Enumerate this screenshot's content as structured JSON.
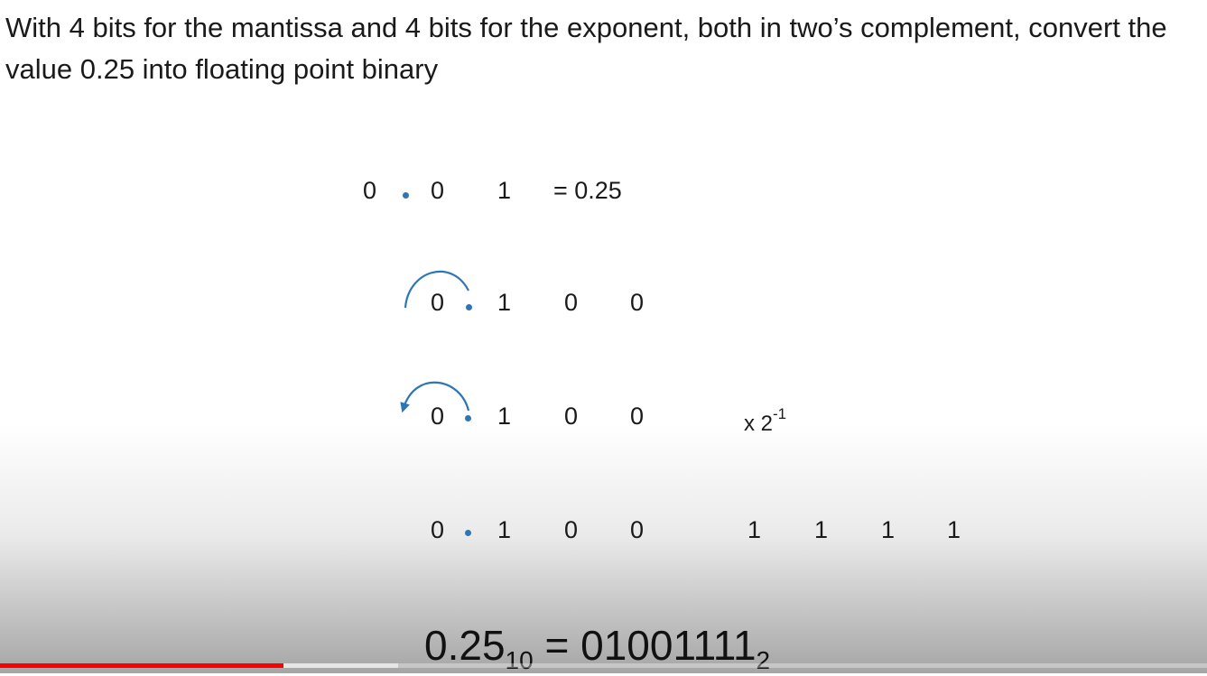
{
  "slide": {
    "title": "With 4 bits for the mantissa and 4 bits for the exponent, both in two’s complement, convert the value 0.25 into floating point binary"
  },
  "rows": {
    "row1": {
      "d1": "0",
      "d2": "0",
      "d3": "1",
      "equals": "= 0.25"
    },
    "row2": {
      "d1": "0",
      "d2": "1",
      "d3": "0",
      "d4": "0"
    },
    "row3": {
      "d1": "0",
      "d2": "1",
      "d3": "0",
      "d4": "0",
      "mult": "x 2",
      "exponent": "-1"
    },
    "row4": {
      "d1": "0",
      "d2": "1",
      "d3": "0",
      "d4": "0",
      "e1": "1",
      "e2": "1",
      "e3": "1",
      "e4": "1"
    }
  },
  "result": {
    "value": "0.25",
    "base_from": "10",
    "equals": "=",
    "binary": "01001111",
    "base_to": "2"
  },
  "player": {
    "progress_played": 0.235,
    "progress_buffered": 0.33
  },
  "colors": {
    "point": "#2e75b6",
    "arrow": "#2e75b6",
    "progress": "#ff0000"
  }
}
